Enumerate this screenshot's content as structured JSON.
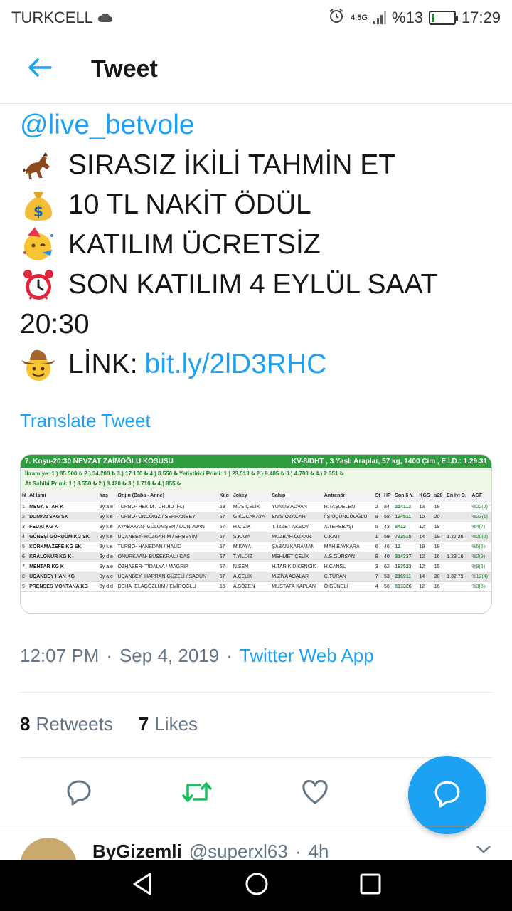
{
  "status_bar": {
    "carrier": "TURKCELL",
    "network": "4.5G",
    "battery": "%13",
    "battery_level": 0.13,
    "time": "17:29"
  },
  "header": {
    "title": "Tweet"
  },
  "tweet": {
    "mention": "@live_betvole",
    "lines": [
      {
        "emoji": "horse-racing-icon",
        "text": "SIRASIZ İKİLİ TAHMİN ET"
      },
      {
        "emoji": "money-bag-icon",
        "text": "10 TL NAKİT ÖDÜL"
      },
      {
        "emoji": "party-face-icon",
        "text": "KATILIM ÜCRETSİZ"
      },
      {
        "emoji": "alarm-clock-icon",
        "text": "SON KATILIM 4 EYLÜL SAAT"
      }
    ],
    "line_wrap": "20:30",
    "link_label": "LİNK: ",
    "link": "bit.ly/2lD3RHC",
    "translate": "Translate Tweet"
  },
  "media": {
    "title": "7. Koşu-20:30 NEVZAT ZAİMOĞLU KOŞUSU",
    "info": "KV-8/DHT , 3 Yaşlı Araplar, 57 kg, 1400 Çim , E.İ.D.: 1.29.31",
    "prize_line1": "İkramiye: 1.) 85.500 ₺  2.) 34.200 ₺  3.) 17.100 ₺  4.) 8.550 ₺   Yetiştirici Primi: 1.) 23.513 ₺  2.) 9.405 ₺  3.) 4.703 ₺  4.) 2.351 ₺",
    "prize_line2": "At Sahibi Primi: 1.) 8.550 ₺  2.) 3.420 ₺  3.) 1.710 ₺  4.) 855 ₺",
    "columns": [
      "N",
      "At İsmi",
      "Yaş",
      "Orijin (Baba - Anne)",
      "Kilo",
      "Jokey",
      "Sahip",
      "Antrenör",
      "St",
      "HP",
      "Son 6 Y.",
      "KGS",
      "s20",
      "En İyi D.",
      "AGF"
    ],
    "rows": [
      [
        "1",
        "MEGA STAR K",
        "3y a e",
        "TURBO- HEKİM / DRUID (FL)",
        "59",
        "MÜS.ÇELİK",
        "YUNUS ADVAN",
        "R.TAŞDELEN",
        "2",
        "84",
        "214113",
        "13",
        "19",
        "",
        "%22(2)"
      ],
      [
        "2",
        "DUMAN SKG SK",
        "3y k e",
        "TURBO- ÖNCÜKIZ / SERHANBEY",
        "57",
        "G.KOCAKAYA",
        "ENİS ÖZACAR",
        "İ.Ş.ÜÇÜNCÜOĞLU",
        "9",
        "58",
        "124811",
        "10",
        "20",
        "",
        "%23(1)"
      ],
      [
        "3",
        "FEDAİ KG K",
        "3y k e",
        "AYABAKAN- GÜLÜMŞEN / DON JUAN",
        "57",
        "H.ÇİZİK",
        "T. İZZET AKSOY",
        "A.TEPEBAŞI",
        "5",
        "43",
        "5412",
        "12",
        "19",
        "",
        "%4(7)"
      ],
      [
        "4",
        "GÜNEŞİ GÖRDÜM KG SK",
        "3y k e",
        "UÇANBEY- RÜZGARIM / ERBEYİM",
        "57",
        "S.KAYA",
        "MUZBAH ÖZKAN",
        "C.KATI",
        "1",
        "59",
        "732515",
        "14",
        "19",
        "1.32.26",
        "%20(3)"
      ],
      [
        "5",
        "KORKMAZEFE KG SK",
        "3y k e",
        "TURBO- HANEDAN / HALID",
        "57",
        "M.KAYA",
        "ŞABAN KARAMAN",
        "MAH.BAYKARA",
        "6",
        "46",
        "12",
        "19",
        "19",
        "",
        "%5(6)"
      ],
      [
        "6",
        "KRALONUR KG K",
        "3y d e",
        "ONURKAAN- BUSEKRAL / CAŞ",
        "57",
        "T.YILDIZ",
        "MEHMET ÇELİK",
        "A.S.GÜRSAN",
        "8",
        "40",
        "314337",
        "12",
        "16",
        "1.33.16",
        "%2(9)"
      ],
      [
        "7",
        "MEHTAR KG K",
        "3y a e",
        "ÖZHABER- TİDALYA / MAGRIP",
        "57",
        "N.ŞEN",
        "H.TARIK DİKENCİK",
        "H.CANSU",
        "3",
        "62",
        "163523",
        "12",
        "15",
        "",
        "%9(5)"
      ],
      [
        "8",
        "UÇANBEY HAN KG",
        "3y a e",
        "UÇANBEY- HARRAN GÜZELİ / SADUN",
        "57",
        "A.ÇELİK",
        "M.ZİYA ADALAR",
        "C.TURAN",
        "7",
        "53",
        "216911",
        "14",
        "20",
        "1.32.79",
        "%12(4)"
      ],
      [
        "9",
        "PRENSES MONTANA KG",
        "3y d d",
        "DEHA- ELAGÖZLÜM / EMİROĞLU",
        "55",
        "A.SÖZEN",
        "MUSTAFA KAPLAN",
        "Ö.GÜNELİ",
        "4",
        "56",
        "513326",
        "12",
        "16",
        "",
        "%3(8)"
      ]
    ]
  },
  "meta": {
    "time": "12:07 PM",
    "date": "Sep 4, 2019",
    "sep": "·",
    "source": "Twitter Web App"
  },
  "stats": {
    "retweets_count": "8",
    "retweets_label": "Retweets",
    "likes_count": "7",
    "likes_label": "Likes"
  },
  "reply": {
    "name": "ByGizemli",
    "handle": "@superxl63",
    "sep": "·",
    "time": "4h"
  },
  "colors": {
    "accent": "#1da1f2",
    "retweet": "#17bf63",
    "text": "#14171a",
    "muted": "#657786"
  }
}
